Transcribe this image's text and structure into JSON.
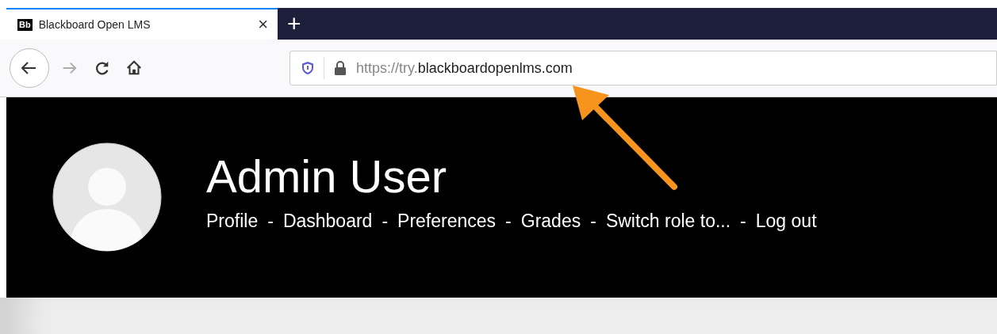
{
  "tab": {
    "title": "Blackboard Open LMS",
    "favicon": "Bb",
    "close": "×",
    "selected": true
  },
  "new_tab": "+",
  "address_bar": {
    "url_prefix": "https://try.",
    "url_domain": "blackboardopenlms.com"
  },
  "header": {
    "name": "Admin User",
    "links": [
      {
        "label": "Profile",
        "separator": "-"
      },
      {
        "label": "Dashboard",
        "separator": "-"
      },
      {
        "label": "Preferences",
        "separator": "-"
      },
      {
        "label": "Grades",
        "separator": "-"
      },
      {
        "label": "Switch role to...",
        "separator": "-"
      },
      {
        "label": "Log out"
      }
    ]
  }
}
